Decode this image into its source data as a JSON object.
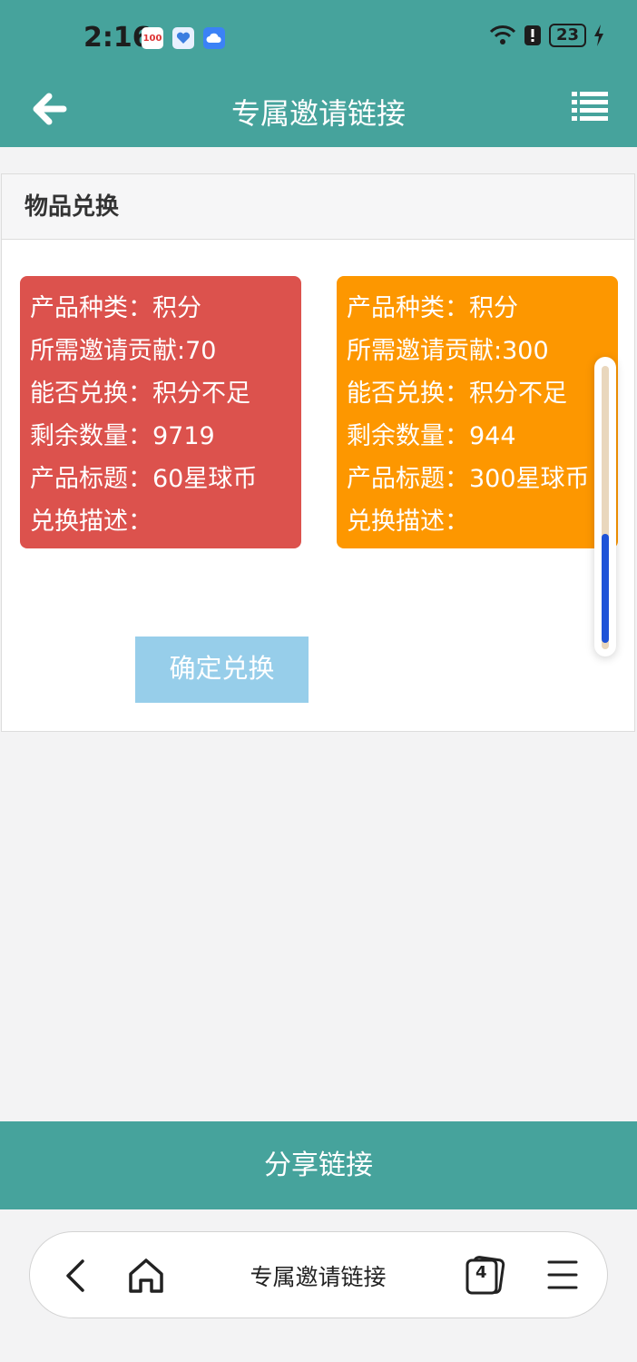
{
  "status_bar": {
    "time": "2:16",
    "battery": "23",
    "notif_1_label": "100"
  },
  "header": {
    "title": "专属邀请链接"
  },
  "panel": {
    "title": "物品兑换",
    "cards": [
      {
        "color": "#dc524d",
        "lines": [
          "产品种类：积分",
          "所需邀请贡献:70",
          "能否兑换：积分不足",
          "剩余数量：9719",
          "产品标题：60星球币",
          "兑换描述："
        ]
      },
      {
        "color": "#fd9700",
        "lines": [
          "产品种类：积分",
          "所需邀请贡献:300",
          "能否兑换：积分不足",
          "剩余数量：944",
          "产品标题：300星球币",
          "兑换描述："
        ]
      }
    ],
    "confirm_label": "确定兑换"
  },
  "share_bar": {
    "label": "分享链接"
  },
  "browser_bar": {
    "title": "专属邀请链接",
    "tab_count": "4"
  },
  "colors": {
    "teal": "#46a39c",
    "button_blue": "#97ceea"
  }
}
